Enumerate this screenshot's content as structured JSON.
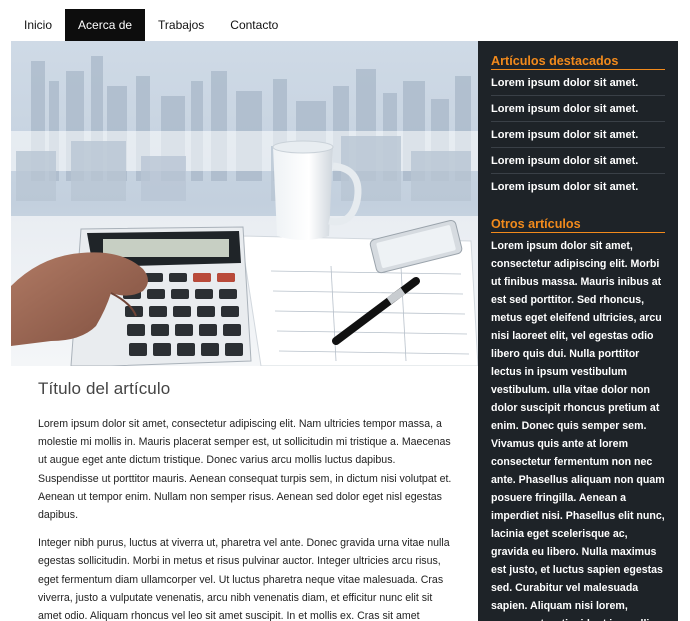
{
  "nav": {
    "items": [
      {
        "label": "Inicio"
      },
      {
        "label": "Acerca de"
      },
      {
        "label": "Trabajos"
      },
      {
        "label": "Contacto"
      }
    ]
  },
  "hero": {
    "icon": "office-desk-calculator-photo"
  },
  "article": {
    "title": "Título del artículo",
    "paragraphs": [
      "Lorem ipsum dolor sit amet, consectetur adipiscing elit. Nam ultricies tempor massa, a molestie mi mollis in. Mauris placerat semper est, ut sollicitudin mi tristique a. Maecenas ut augue eget ante dictum tristique. Donec varius arcu mollis luctus dapibus. Suspendisse ut porttitor mauris. Aenean consequat turpis sem, in dictum nisi volutpat et. Aenean ut tempor enim. Nullam non semper risus. Aenean sed dolor eget nisl egestas dapibus.",
      "Integer nibh purus, luctus at viverra ut, pharetra vel ante. Donec gravida urna vitae nulla egestas sollicitudin. Morbi in metus et risus pulvinar auctor. Integer ultricies arcu risus, eget fermentum diam ullamcorper vel. Ut luctus pharetra neque vitae malesuada. Cras viverra, justo a vulputate venenatis, arcu nibh venenatis diam, et efficitur nunc elit sit amet odio. Aliquam rhoncus vel leo sit amet suscipit. In et mollis ex. Cras sit amet"
    ]
  },
  "sidebar": {
    "featured_title": "Artículos destacados",
    "featured": [
      {
        "label": "Lorem ipsum dolor sit amet."
      },
      {
        "label": "Lorem ipsum dolor sit amet."
      },
      {
        "label": "Lorem ipsum dolor sit amet."
      },
      {
        "label": "Lorem ipsum dolor sit amet."
      },
      {
        "label": "Lorem ipsum dolor sit amet."
      }
    ],
    "other_title": "Otros artículos",
    "other_text": "Lorem ipsum dolor sit amet, consectetur adipiscing elit. Morbi ut finibus massa. Mauris inibus at est sed porttitor. Sed rhoncus, metus eget eleifend ultricies, arcu nisi laoreet elit, vel egestas odio libero quis dui. Nulla porttitor lectus in ipsum vestibulum vestibulum. ulla vitae dolor non dolor suscipit rhoncus pretium at enim. Donec quis semper sem. Vivamus quis ante at lorem consectetur fermentum non nec ante. Phasellus aliquam non quam posuere fringilla. Aenean a imperdiet nisi. Phasellus elit nunc, lacinia eget scelerisque ac, gravida eu libero. Nulla maximus est justo, et luctus sapien egestas sed. Curabitur vel malesuada sapien. Aliquam nisi lorem, consequat ac tincidunt in, mollis ac"
  },
  "colors": {
    "accent": "#f28a1c",
    "sidebar_bg": "#1e2328",
    "nav_active": "#0d0d0d"
  }
}
